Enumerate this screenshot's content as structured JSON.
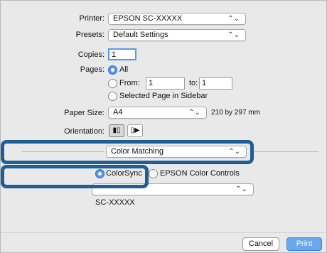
{
  "printer": {
    "label": "Printer:",
    "value": "EPSON SC-XXXXX"
  },
  "presets": {
    "label": "Presets:",
    "value": "Default Settings"
  },
  "copies": {
    "label": "Copies:",
    "value": "1"
  },
  "pages": {
    "label": "Pages:",
    "all_label": "All",
    "from_label": "From:",
    "from_value": "1",
    "to_label": "to:",
    "to_value": "1",
    "selected_label": "Selected Page in Sidebar"
  },
  "paper_size": {
    "label": "Paper Size:",
    "value": "A4",
    "dimensions": "210 by 297 mm"
  },
  "orientation": {
    "label": "Orientation:"
  },
  "section_popup": {
    "value": "Color Matching"
  },
  "color": {
    "colorsync_label": "ColorSync",
    "epson_label": "EPSON Color Controls",
    "profile_value": ""
  },
  "device_name": "SC-XXXXX",
  "buttons": {
    "cancel": "Cancel",
    "print": "Print"
  },
  "icons": {
    "popup_arrows": "updown-chevron-icon",
    "portrait": "portrait-icon",
    "landscape": "landscape-icon"
  },
  "colors": {
    "highlight": "#1f5f98",
    "accent": "#5b96ec",
    "dialog_bg": "#e9e9e9"
  }
}
